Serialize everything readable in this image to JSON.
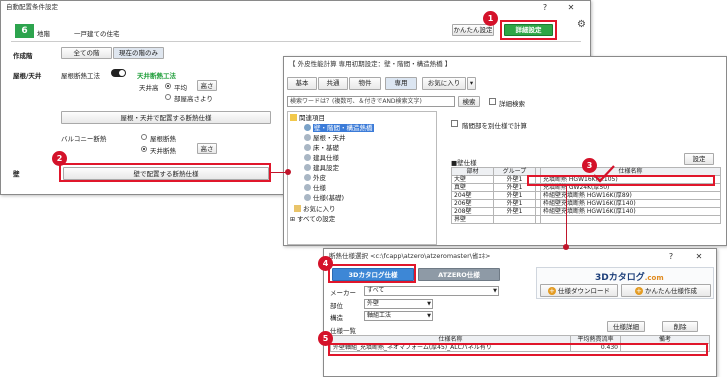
{
  "main_window": {
    "title": "自動配置条件設定",
    "floor_badge": "6",
    "floor_label": "地階",
    "house_type": "一戸建ての住宅",
    "easy_settings_btn": "かんたん設定",
    "detail_settings_btn": "詳細設定",
    "help": "?",
    "close": "✕",
    "target_floor_label": "作成階",
    "all_floors_btn": "全ての階",
    "current_floor_btn": "現在の階のみ",
    "roof_label": "屋根/天井",
    "roof_insulation_label": "屋根断熱工法",
    "ceiling_insulation": "天井断熱工法",
    "ceiling_height_label": "天井高",
    "average_label": "平均",
    "height_btn": "高さ",
    "room_height_label": "部屋高さより",
    "roof_ceiling_btn": "屋根・天井で配置する断熱仕様",
    "balcony_label": "バルコニー断熱",
    "floor_insulation": "屋根断熱",
    "ceiling_insulation2": "天井断熱",
    "height_btn2": "高さ",
    "wall_label": "壁",
    "wall_btn": "壁で配置する断熱仕様"
  },
  "spec_window": {
    "title": "【 外皮性能計算 専用初期設定：壁・階間・構造熱橋 】",
    "tabs": [
      "基本",
      "共通",
      "物件",
      "専用",
      "お気に入り"
    ],
    "search_placeholder": "検索ワードは？(複数可、＆付きでAND検索文字)",
    "search_btn": "検索",
    "detail_search": "詳細検索",
    "tree_root": "関連項目",
    "tree_items": [
      "壁・階間・構造熱橋",
      "屋根・天井",
      "床・基礎",
      "建具仕様",
      "建具設定",
      "外皮",
      "仕様",
      "仕様(基礎)"
    ],
    "favorites": "お気に入り",
    "all_settings": "すべての設定",
    "separate_floor_check": "階間部を別仕様で計算",
    "wall_spec_label": "■壁仕様",
    "settings_btn": "設定",
    "table_headers": [
      "部材",
      "グループ",
      "",
      "仕様名称"
    ],
    "table_rows": [
      [
        "大壁",
        "外壁1",
        "",
        "充填断熱 HGW16K(厚105)"
      ],
      [
        "真壁",
        "外壁1",
        "",
        "充填断熱 GW24K(厚50)"
      ],
      [
        "204壁",
        "外壁1",
        "",
        "枠組壁充填断熱 HGW16K(厚89)"
      ],
      [
        "206壁",
        "外壁1",
        "",
        "枠組壁充填断熱 HGW16K(厚140)"
      ],
      [
        "208壁",
        "外壁1",
        "",
        "枠組壁充填断熱 HGW16K(厚140)"
      ],
      [
        "界壁",
        "",
        "",
        ""
      ]
    ]
  },
  "select_window": {
    "title": "断熱仕様選択 <c:\\fcapp\\atzero\\atzeromaster\\省ｴﾈ>",
    "help": "?",
    "close": "✕",
    "tab_3d": "3Dカタログ仕様",
    "tab_atzero": "ATZERO仕様",
    "logo_text": "3Dカタログ",
    "logo_suffix": ".com",
    "download_btn": "仕様ダウンロード",
    "easy_create_btn": "かんたん仕様作成",
    "maker_label": "メーカー",
    "maker_value": "すべて",
    "part_label": "部位",
    "part_value": "外壁",
    "structure_label": "構造",
    "structure_value": "軸組工法",
    "list_label": "仕様一覧",
    "detail_btn": "仕様詳細",
    "delete_btn": "削除",
    "list_headers": [
      "仕様名称",
      "平均熱貫流率",
      "備考"
    ],
    "list_rows": [
      [
        "外壁軸組_充填断熱_ネオマフォーム(厚45)_ALCパネル有り",
        "0.430",
        ""
      ]
    ]
  },
  "badges": [
    "1",
    "2",
    "3",
    "4",
    "5"
  ],
  "colors": {
    "accent_green": "#1f9e3a",
    "badge_red": "#d4122a",
    "tab_blue": "#2f7fd1"
  }
}
